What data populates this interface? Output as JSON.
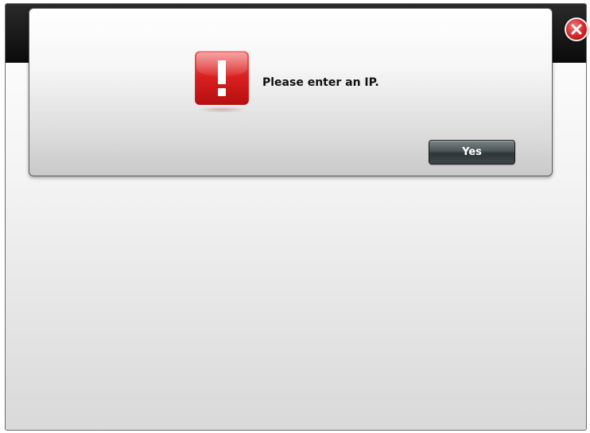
{
  "alert": {
    "icon": "exclamation-alert-icon",
    "message": "Please enter an IP.",
    "yes_label": "Yes"
  },
  "window": {
    "close_icon": "close-icon"
  },
  "colors": {
    "alert_red": "#d81f1f",
    "button_dark": "#3d4547",
    "titlebar": "#0b0b0b"
  }
}
